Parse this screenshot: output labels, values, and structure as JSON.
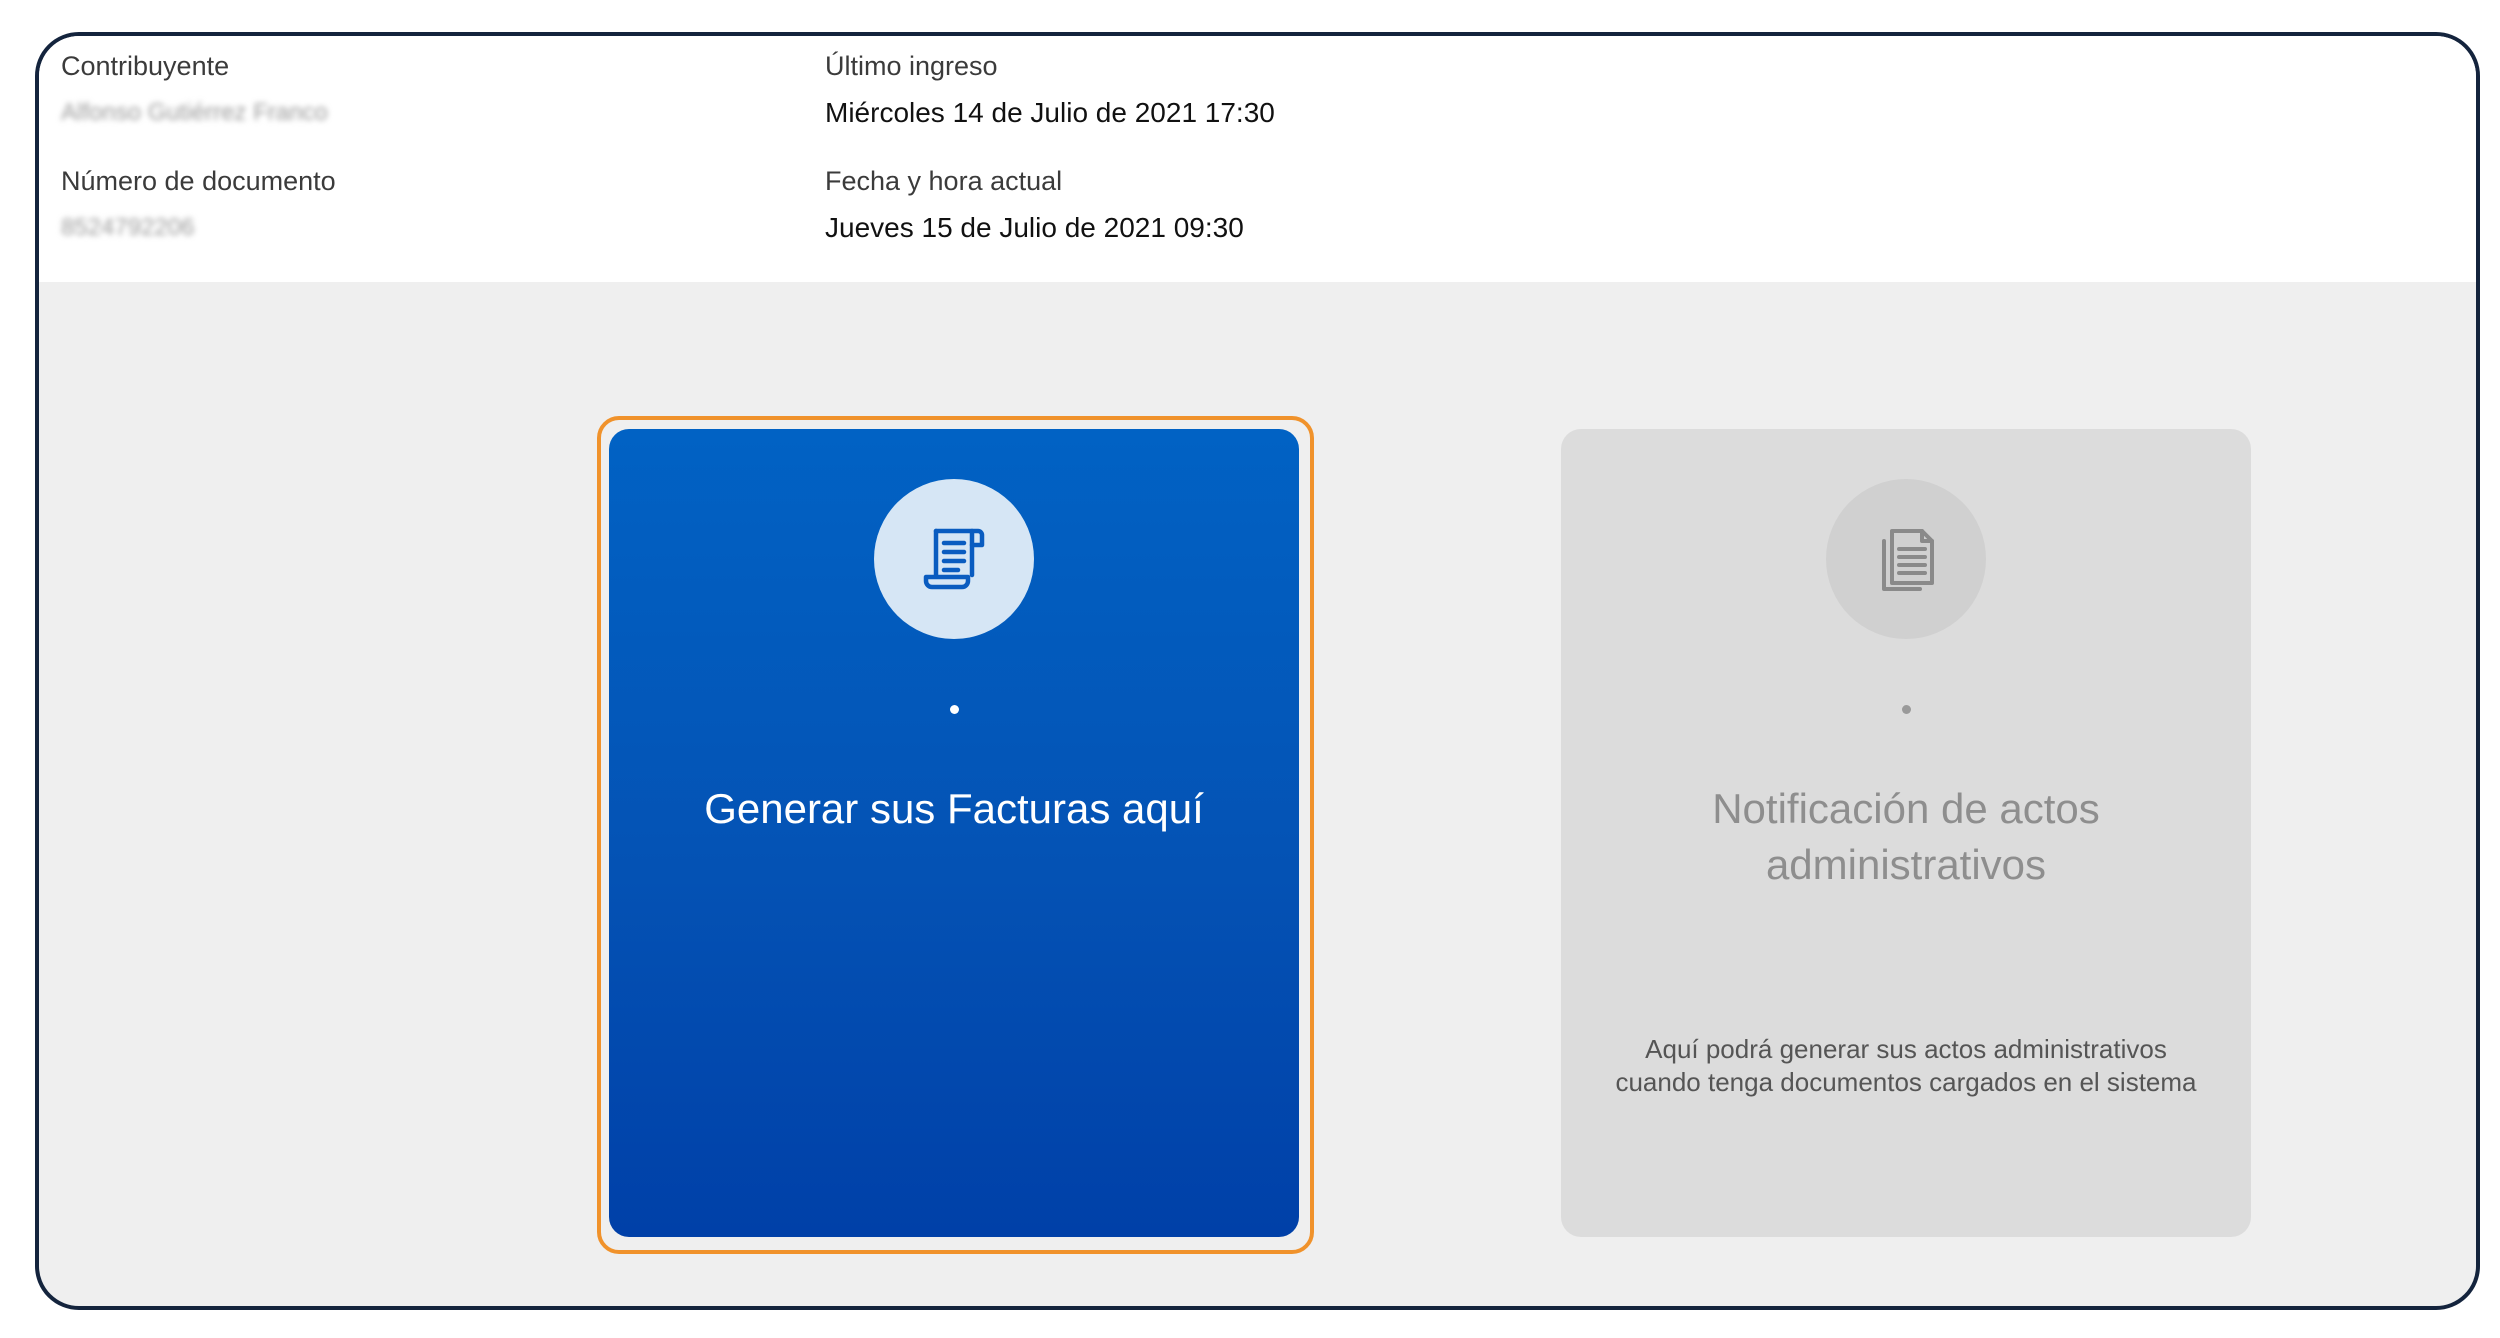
{
  "info": {
    "contribuyente_label": "Contribuyente",
    "contribuyente_value": "Alfonso Gutiérrez Franco",
    "documento_label": "Número de documento",
    "documento_value": "8524792206",
    "ultimo_ingreso_label": "Último ingreso",
    "ultimo_ingreso_value": "Miércoles 14 de Julio de 2021 17:30",
    "fecha_actual_label": "Fecha y hora actual",
    "fecha_actual_value": "Jueves 15 de Julio de 2021 09:30"
  },
  "cards": {
    "facturas": {
      "title": "Generar sus Facturas aquí",
      "icon": "invoice-scroll-icon",
      "color": "#0452b4",
      "highlighted": true
    },
    "notificacion": {
      "title": "Notificación de actos administrativos",
      "description": "Aquí podrá generar sus actos administrativos cuando tenga documentos cargados en el sistema",
      "icon": "documents-icon",
      "color": "#dcdcdc",
      "disabled": true
    }
  },
  "colors": {
    "highlight_border": "#f0922b",
    "frame_border": "#14243d"
  }
}
